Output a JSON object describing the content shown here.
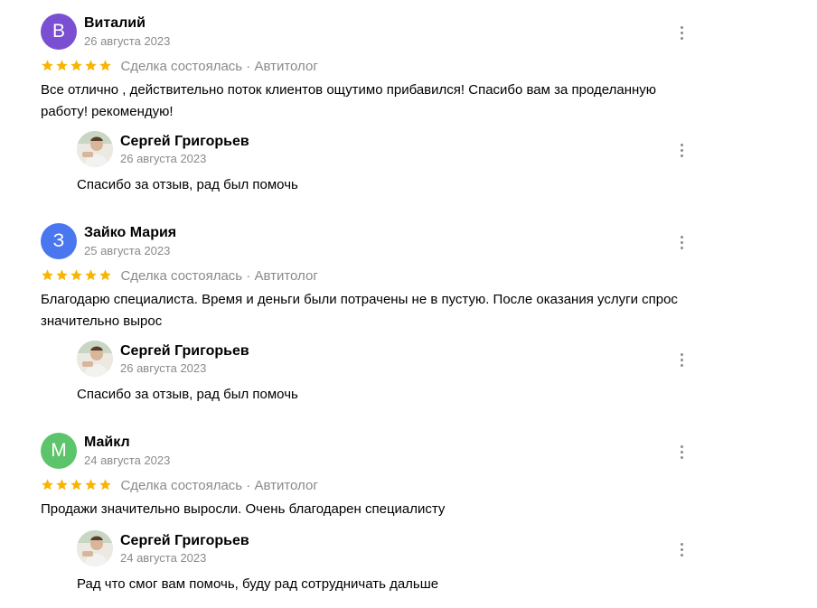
{
  "reviews": [
    {
      "author": "Виталий",
      "initial": "В",
      "avatar_color": "#7b4fd1",
      "date": "26 августа 2023",
      "rating": 5,
      "meta": "Сделка состоялась · Автитолог",
      "text": "Все отлично , действительно поток клиентов ощутимо прибавился! Спасибо вам за проделанную работу! рекомендую!",
      "reply": {
        "author": "Сергей Григорьев",
        "date": "26 августа 2023",
        "text": "Спасибо за отзыв, рад был помочь"
      }
    },
    {
      "author": "Зайко Мария",
      "initial": "З",
      "avatar_color": "#4a76f0",
      "date": "25 августа 2023",
      "rating": 5,
      "meta": "Сделка состоялась · Автитолог",
      "text": "Благодарю специалиста. Время и деньги были потрачены не в пустую. После оказания услуги спрос значительно вырос",
      "reply": {
        "author": "Сергей Григорьев",
        "date": "26 августа 2023",
        "text": "Спасибо за отзыв, рад был помочь"
      }
    },
    {
      "author": "Майкл",
      "initial": "М",
      "avatar_color": "#5cc46a",
      "date": "24 августа 2023",
      "rating": 5,
      "meta": "Сделка состоялась · Автитолог",
      "text": "Продажи значительно выросли. Очень благодарен специалисту",
      "reply": {
        "author": "Сергей Григорьев",
        "date": "24 августа 2023",
        "text": "Рад что смог вам помочь, буду рад сотрудничать дальше"
      }
    }
  ],
  "colors": {
    "star": "#f7b500",
    "muted": "#8a8a8a"
  },
  "icons": {
    "menu": "more-vertical-icon",
    "star": "star-icon"
  }
}
